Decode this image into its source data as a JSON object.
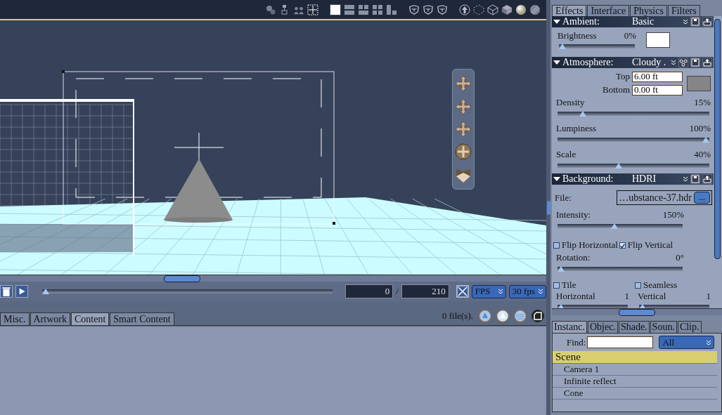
{
  "viewport_toolbar": {
    "layouts": [
      {
        "selected": true
      },
      {
        "selected": false
      },
      {
        "selected": false
      },
      {
        "selected": false
      },
      {
        "selected": false
      }
    ]
  },
  "timeline": {
    "level": 0,
    "current_frame": "0",
    "separator": "/",
    "end_frame": "210",
    "mode": "FPS",
    "fps": "30 fps"
  },
  "library": {
    "tabs": [
      {
        "label": "Misc.",
        "selected": false
      },
      {
        "label": "Artwork",
        "selected": false
      },
      {
        "label": "Content",
        "selected": true
      },
      {
        "label": "Smart Content",
        "selected": false
      }
    ],
    "status": "0 file(s)."
  },
  "side_tabs": [
    {
      "label": "Effects",
      "selected": true
    },
    {
      "label": "Interface",
      "selected": false
    },
    {
      "label": "Physics",
      "selected": false
    },
    {
      "label": "Filters",
      "selected": false
    }
  ],
  "ambient": {
    "title": "Ambient:",
    "preset": "Basic",
    "brightness": {
      "label": "Brightness",
      "reading": "0%",
      "level": 0
    }
  },
  "atmosphere": {
    "title": "Atmosphere:",
    "preset": "Cloudy .",
    "fields": [
      {
        "label": "Top",
        "value": "6.00 ft"
      },
      {
        "label": "Bottom",
        "value": "0.00 ft"
      }
    ],
    "sliders": [
      {
        "label": "Density",
        "reading": "15%",
        "level": 0.15
      },
      {
        "label": "Lumpiness",
        "reading": "100%",
        "level": 1
      },
      {
        "label": "Scale",
        "reading": "40%",
        "level": 0.4
      }
    ]
  },
  "background": {
    "title": "Background:",
    "preset": "HDRI",
    "file_label": "File:",
    "file": "…ubstance-37.hdr",
    "browse": "...",
    "intensity": {
      "label": "Intensity:",
      "reading": "150%",
      "level": 0.45
    },
    "flips": [
      {
        "label": "Flip Horizontal",
        "checked": false
      },
      {
        "label": "Flip Vertical",
        "checked": true
      }
    ],
    "rotation": {
      "label": "Rotation:",
      "reading": "0°",
      "level": 0
    },
    "tile_options": [
      {
        "label": "Tile",
        "checked": false
      },
      {
        "label": "Seamless",
        "checked": false
      }
    ],
    "tile_sliders": [
      {
        "label": "Horizontal",
        "reading": "1",
        "level": 0
      },
      {
        "label": "Vertical",
        "reading": "1",
        "level": 0
      }
    ]
  },
  "outliner": {
    "tabs": [
      {
        "label": "Instanc.",
        "selected": true
      },
      {
        "label": "Objec.",
        "selected": false
      },
      {
        "label": "Shade.",
        "selected": false
      },
      {
        "label": "Soun.",
        "selected": false
      },
      {
        "label": "Clip.",
        "selected": false
      }
    ],
    "find_label": "Find:",
    "filter": "All",
    "tree": [
      {
        "label": "Scene",
        "selected": true,
        "children": [
          {
            "label": "Camera 1",
            "selected": false
          },
          {
            "label": "Infinite reflect",
            "selected": false
          },
          {
            "label": "Cone",
            "selected": false
          }
        ]
      }
    ]
  }
}
